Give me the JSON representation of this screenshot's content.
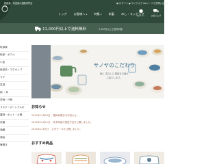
{
  "header": {
    "note": "砥部焼・有田焼の通販専門店",
    "utility_links": [
      {
        "icon": "lock-icon",
        "label": "ログイン"
      },
      {
        "icon": "user-icon",
        "label": "マイアカウント"
      },
      {
        "icon": "mail-icon",
        "label": "メールでお問い合わせ"
      }
    ],
    "nav": [
      {
        "label": "トップ",
        "has_caret": false
      },
      {
        "label": "お客様へ",
        "has_caret": true
      },
      {
        "label": "特集",
        "has_caret": true
      },
      {
        "label": "新着",
        "has_caret": false
      },
      {
        "label": "のし・ラッピング",
        "has_caret": false
      }
    ],
    "icon_buttons": [
      {
        "icon": "user-icon",
        "label": "ログイン"
      },
      {
        "icon": "cart-icon",
        "label": "お買い上げ"
      }
    ]
  },
  "promo": {
    "main": "11,000円以上で送料無料",
    "sub": "3,300円以上で送料半額"
  },
  "sidebar": {
    "items": [
      "砥部焼",
      "砥部・ボウル",
      "小皿",
      "砥部皿・マグカップ",
      "マグ",
      "急須",
      "碗 ・丼",
      "茶碗・汁椀",
      "ラスク・ボーンブルボ",
      "蓋物・ポット・土鍋",
      "花器",
      "酒器",
      "湯呑",
      "箸置き"
    ]
  },
  "hero": {
    "title": "サノヤのこだわり",
    "subtitle_line1": "細く 暮らしに選品をお届け",
    "subtitle_line2": "ご紹介します。"
  },
  "news": {
    "title": "お知らせ",
    "items": [
      {
        "date": "2021年11月16日",
        "text": "- 臨時休業日のお知らせ。"
      },
      {
        "date": "2021年11月11日",
        "text": "- 年末年始の発送予定を公開しました。"
      },
      {
        "date": "2021年11月1日",
        "text": "- 立冬セールを公開しました。"
      }
    ]
  },
  "recommended": {
    "title": "おすすめ商品"
  },
  "colors": {
    "header_bg": "#2f4a3a",
    "promo_bg": "#45604f",
    "news_text": "#a66c58",
    "hero_title": "#3b6f8a"
  }
}
